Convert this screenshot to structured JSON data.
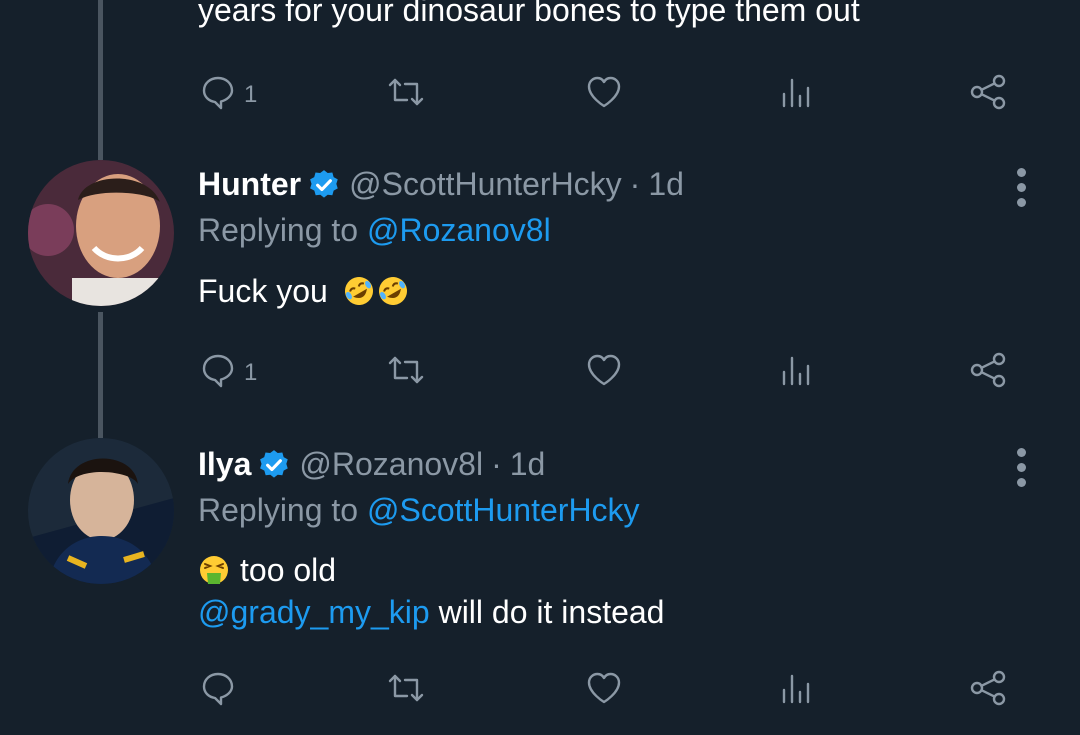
{
  "top_tweet": {
    "text_fragment": "years for your dinosaur bones to type them out",
    "actions": {
      "reply_count": "1",
      "retweet_count": "",
      "like_count": ""
    }
  },
  "tweets": [
    {
      "name": "Hunter",
      "handle": "@ScottHunterHcky",
      "dot": "·",
      "time": "1d",
      "replying_prefix": "Replying to ",
      "replying_to": "@Rozanov8l",
      "text": "Fuck you",
      "emojis": [
        "rolling-on-floor-laughing",
        "rolling-on-floor-laughing"
      ],
      "actions": {
        "reply_count": "1"
      }
    },
    {
      "name": "Ilya",
      "handle": "@Rozanov8l",
      "dot": "·",
      "time": "1d",
      "replying_prefix": "Replying to ",
      "replying_to": "@ScottHunterHcky",
      "text_line1": "too old",
      "line1_emoji": "face-vomiting",
      "mention": "@grady_my_kip",
      "text_line2": " will do it instead",
      "actions": {
        "reply_count": ""
      }
    }
  ],
  "colors": {
    "background": "#15202b",
    "text": "#ffffff",
    "secondary": "#8b98a5",
    "accent": "#1d9bf0",
    "thread_line": "#4a5560"
  },
  "icons": [
    "reply-icon",
    "retweet-icon",
    "like-icon",
    "views-icon",
    "share-icon",
    "verified-badge-icon",
    "more-options-icon"
  ]
}
